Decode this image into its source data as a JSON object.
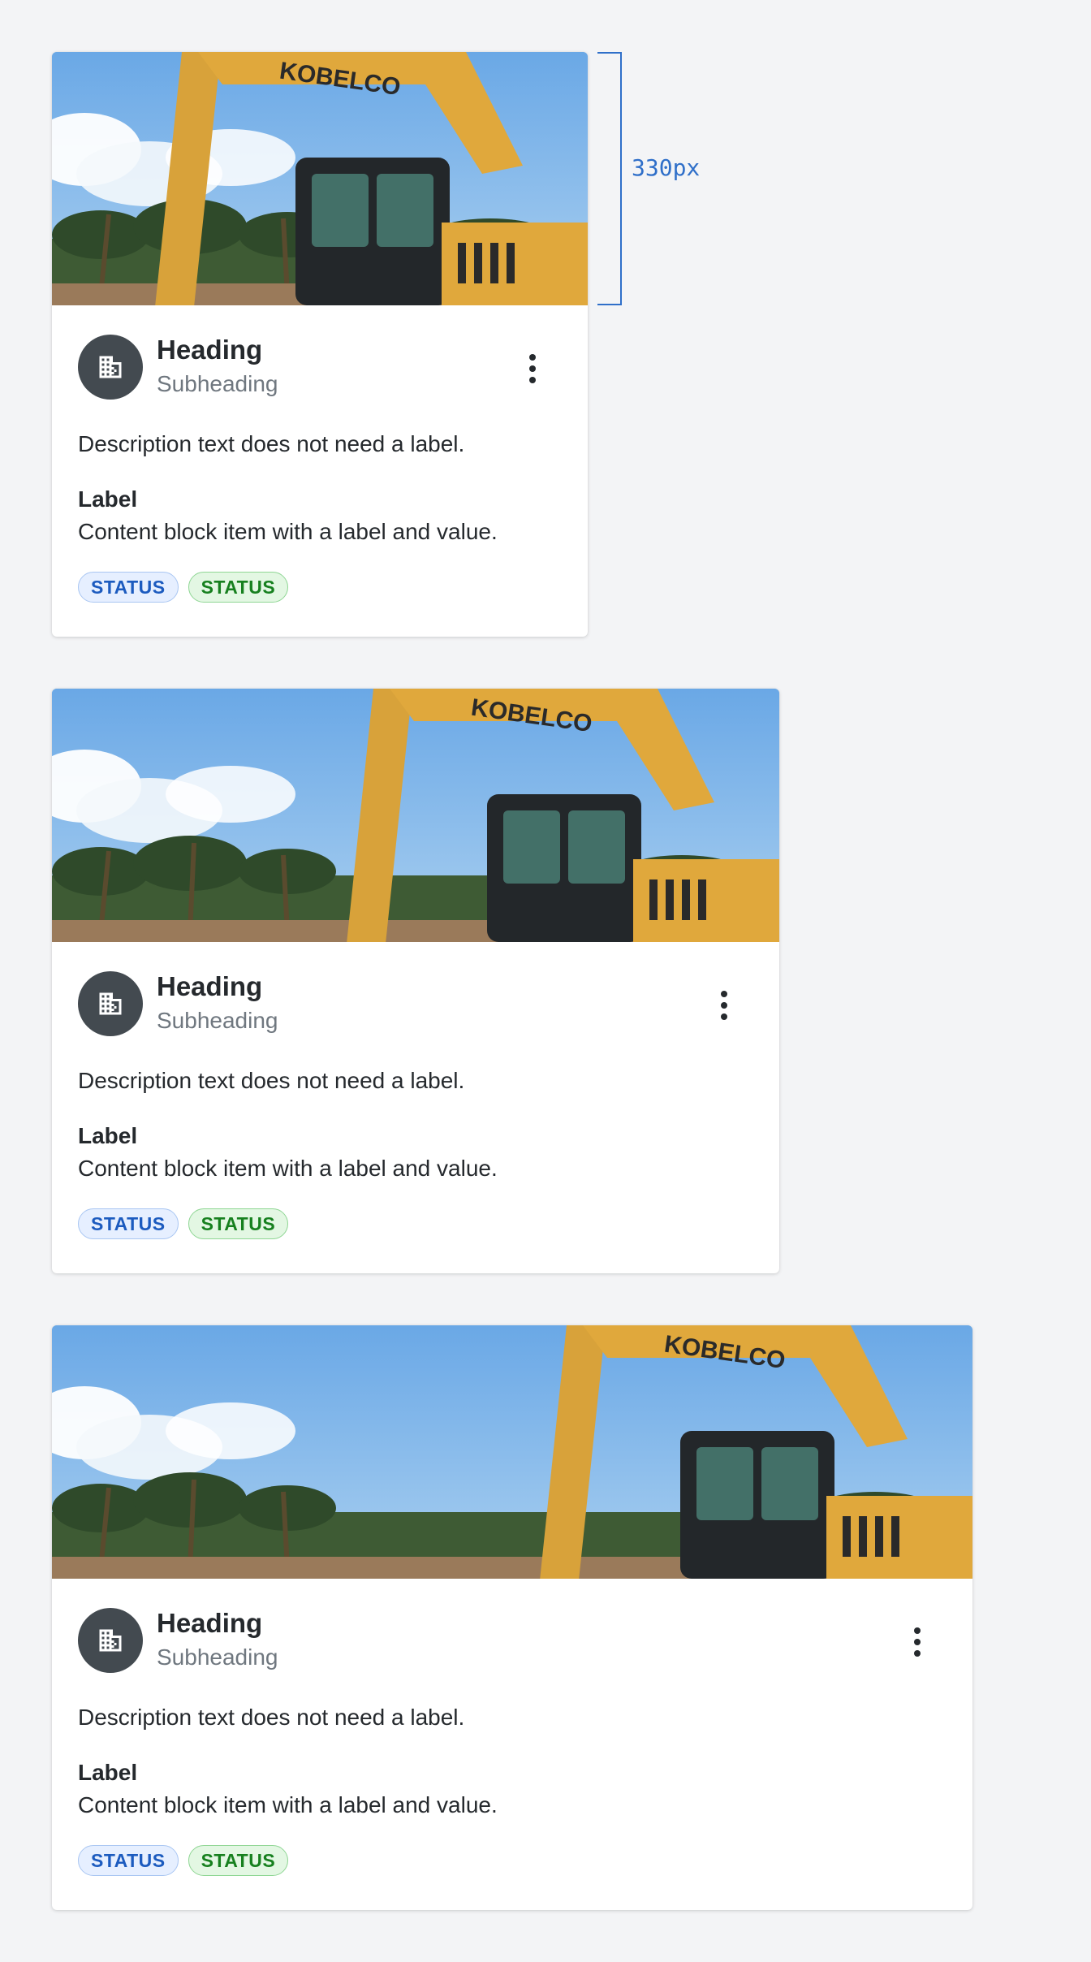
{
  "dimension_label": "330px",
  "cards": [
    {
      "heading": "Heading",
      "subheading": "Subheading",
      "description": "Description text does not need a label.",
      "label": "Label",
      "value": "Content block item with a label and value.",
      "tags": [
        "STATUS",
        "STATUS"
      ]
    },
    {
      "heading": "Heading",
      "subheading": "Subheading",
      "description": "Description text does not need a label.",
      "label": "Label",
      "value": "Content block item with a label and value.",
      "tags": [
        "STATUS",
        "STATUS"
      ]
    },
    {
      "heading": "Heading",
      "subheading": "Subheading",
      "description": "Description text does not need a label.",
      "label": "Label",
      "value": "Content block item with a label and value.",
      "tags": [
        "STATUS",
        "STATUS"
      ]
    }
  ],
  "image_text": "KOBELCO",
  "icons": {
    "avatar": "building-icon",
    "menu": "more-vertical-icon"
  },
  "colors": {
    "background": "#f3f4f6",
    "avatar": "#434a50",
    "status_blue": "#1c5bbf",
    "status_green": "#17801f",
    "dimension": "#2f6fc9"
  }
}
